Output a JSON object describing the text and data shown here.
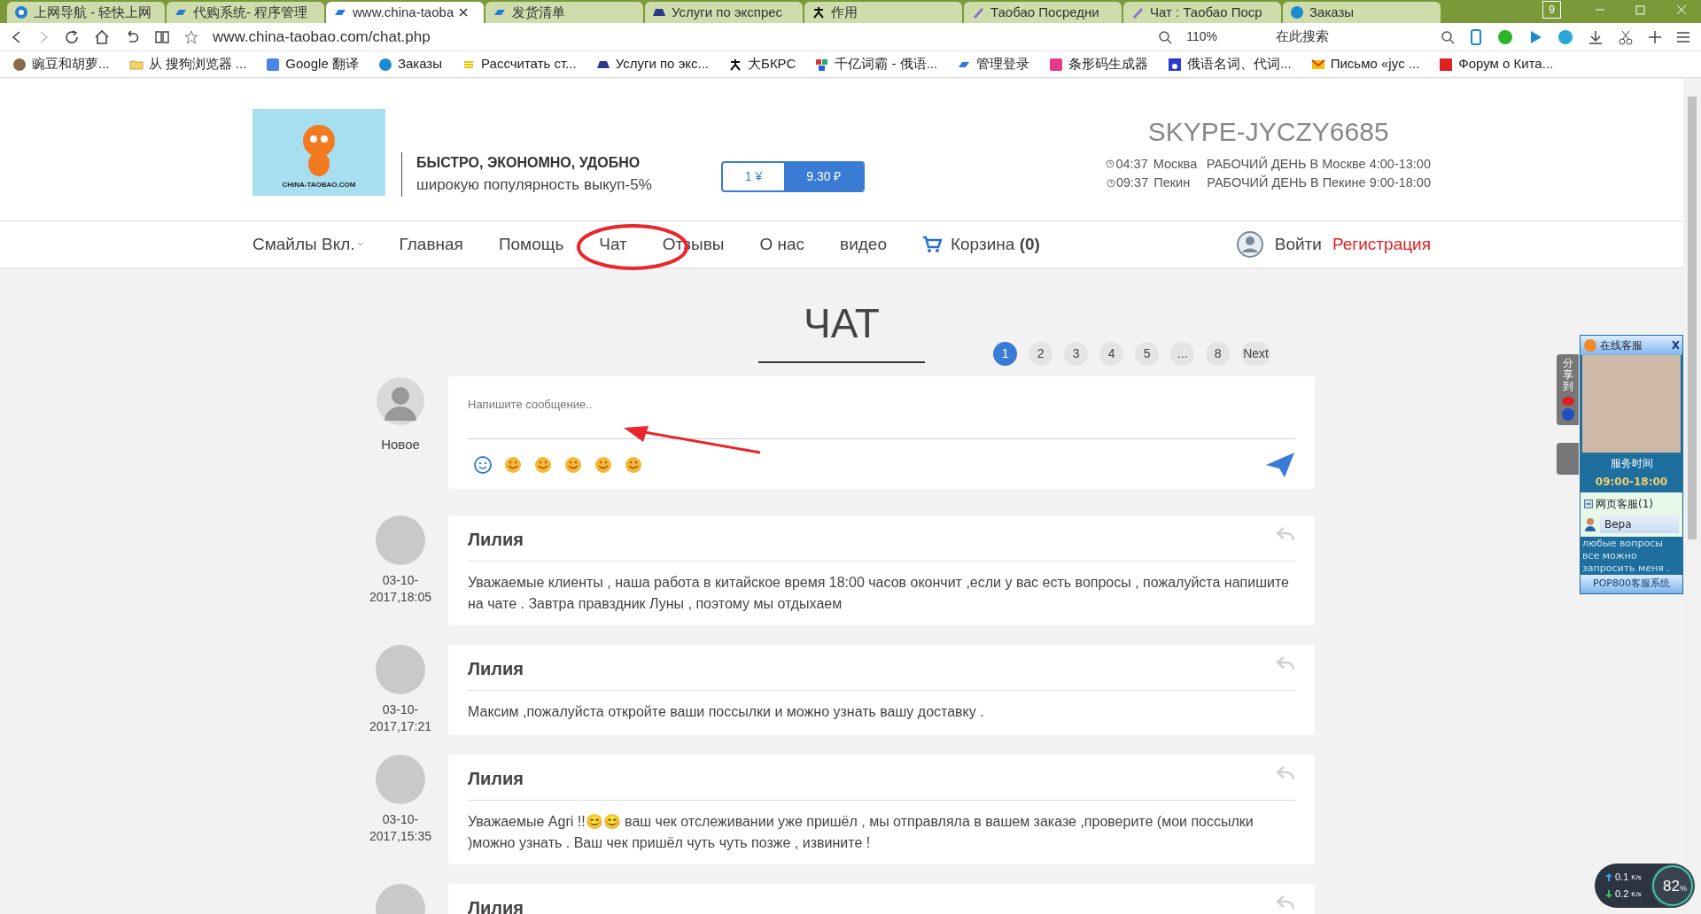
{
  "browser": {
    "tabs": [
      {
        "title": "上网导航 - 轻快上网",
        "selected": false
      },
      {
        "title": "代购系统- 程序管理",
        "selected": false
      },
      {
        "title": "www.china-taoba",
        "selected": true
      },
      {
        "title": "发货清单",
        "selected": false
      },
      {
        "title": "Услуги по экспрес",
        "selected": false
      },
      {
        "title": "作用",
        "selected": false
      },
      {
        "title": "Таобао Посредни",
        "selected": false
      },
      {
        "title": "Чат : Таобао Поср",
        "selected": false
      },
      {
        "title": "Заказы",
        "selected": false
      }
    ],
    "tab_count": "9",
    "url": "www.china-taobao.com/chat.php",
    "zoom": "110%",
    "search_placeholder": "在此搜索",
    "bookmarks": [
      "豌豆和胡萝...",
      "从 搜狗浏览器 ...",
      "Google 翻译",
      "Заказы",
      "Рассчитать ст...",
      "Услуги по экс...",
      "大БКРС",
      "千亿词霸 - 俄语...",
      "管理登录",
      "条形码生成器",
      "俄语名词、代词...",
      "Письмо «jyc ...",
      "Форум о Кита..."
    ]
  },
  "header": {
    "logo_text": "CHINA-TAOBAO.COM",
    "slogan": "БЫСТРО, ЭКОНОМНО, УДОБНО",
    "tagline": "широкую популярность выкуп-5%",
    "currency": [
      {
        "label": "1 ¥",
        "selected": false
      },
      {
        "label": "9.30 ₽",
        "selected": true
      }
    ],
    "skype": "SKYPE-JYCZY6685",
    "clocks": [
      {
        "time": "04:37",
        "city": "Москва",
        "hours": "РАБОЧИЙ ДЕНЬ В Москве 4:00-13:00"
      },
      {
        "time": "09:37",
        "city": "Пекин",
        "hours": "РАБОЧИЙ ДЕНЬ В Пекине 9:00-18:00"
      }
    ]
  },
  "nav": {
    "items": [
      {
        "label": "Смайлы Вкл.",
        "kind": "dropdown"
      },
      {
        "label": "Главная",
        "kind": "link"
      },
      {
        "label": "Помощь",
        "kind": "link"
      },
      {
        "label": "Чат",
        "kind": "link"
      },
      {
        "label": "Отзывы",
        "kind": "link"
      },
      {
        "label": "О нас",
        "kind": "link"
      },
      {
        "label": "видео",
        "kind": "link"
      },
      {
        "label": "Корзина **(0)**",
        "kind": "cart"
      }
    ],
    "login": "Войти",
    "register": "Регистрация"
  },
  "chat": {
    "title": "ЧАТ",
    "pages": [
      {
        "label": "1",
        "selected": true
      },
      {
        "label": "2",
        "selected": false
      },
      {
        "label": "3",
        "selected": false
      },
      {
        "label": "4",
        "selected": false
      },
      {
        "label": "5",
        "selected": false
      },
      {
        "label": "...",
        "selected": false
      },
      {
        "label": "8",
        "selected": false
      },
      {
        "label": "Next",
        "selected": false
      }
    ],
    "composer": {
      "user": "Новое",
      "placeholder": "Напишите сообщение.."
    },
    "messages": [
      {
        "author": "Лилия",
        "date": "03-10-2017,18:05",
        "text": "Уважаемые клиенты , наша работа в китайское время 18:00 часов окончит ,если у вас есть вопросы , пожалуйста напишите на чате . Завтра правздник Луны , поэтому мы отдыхаем"
      },
      {
        "author": "Лилия",
        "date": "03-10-2017,17:21",
        "text": "Максим ,пожалуйста откройте ваши поссылки и можно узнать вашу доставку ."
      },
      {
        "author": "Лилия",
        "date": "03-10-2017,15:35",
        "text": "Уважаемые Agri !!😊😊  ваш чек отслеживании уже пришёл , мы отправляла в вашем заказе ,проверите (мои поссылки )можно узнать . Ваш чек пришёл чуть чуть позже , извините !"
      },
      {
        "author": "Лилия"
      }
    ]
  },
  "support_widget": {
    "title": "在线客服",
    "close": "X",
    "share": "分享到",
    "service_label": "服务时间",
    "service_hours": "09:00-18:00",
    "group": "网页客服(1)",
    "agent": "Вера",
    "note": "любые вопросы все можно запросить меня .",
    "footer": "POP800客服系统"
  },
  "net_meter": {
    "up": "0.1",
    "up_unit": "K/s",
    "down": "0.2",
    "down_unit": "K/s",
    "percent": "82",
    "percent_sign": "%"
  }
}
